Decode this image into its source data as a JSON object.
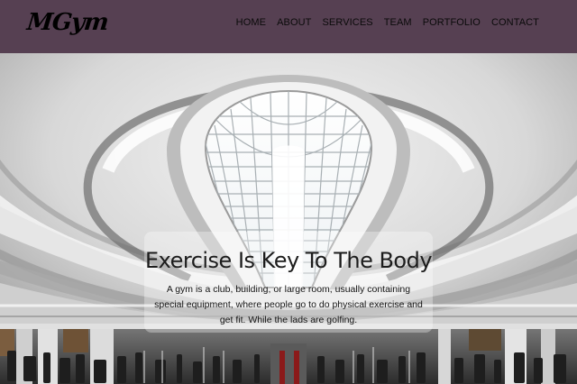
{
  "brand": {
    "logo_text": "MGym"
  },
  "nav": {
    "items": [
      {
        "label": "HOME"
      },
      {
        "label": "ABOUT"
      },
      {
        "label": "SERVICES"
      },
      {
        "label": "TEAM"
      },
      {
        "label": "PORTFOLIO"
      },
      {
        "label": "CONTACT"
      }
    ]
  },
  "hero": {
    "title": "Exercise Is Key To The Body",
    "description": "A gym is a club, building, or large room, usually containing special equipment, where people go to do physical exercise and get fit. While the lads are golfing."
  },
  "colors": {
    "header_bg": "#564052",
    "nav_text": "#0a0a0a",
    "card_bg": "rgba(255,255,255,0.32)"
  }
}
